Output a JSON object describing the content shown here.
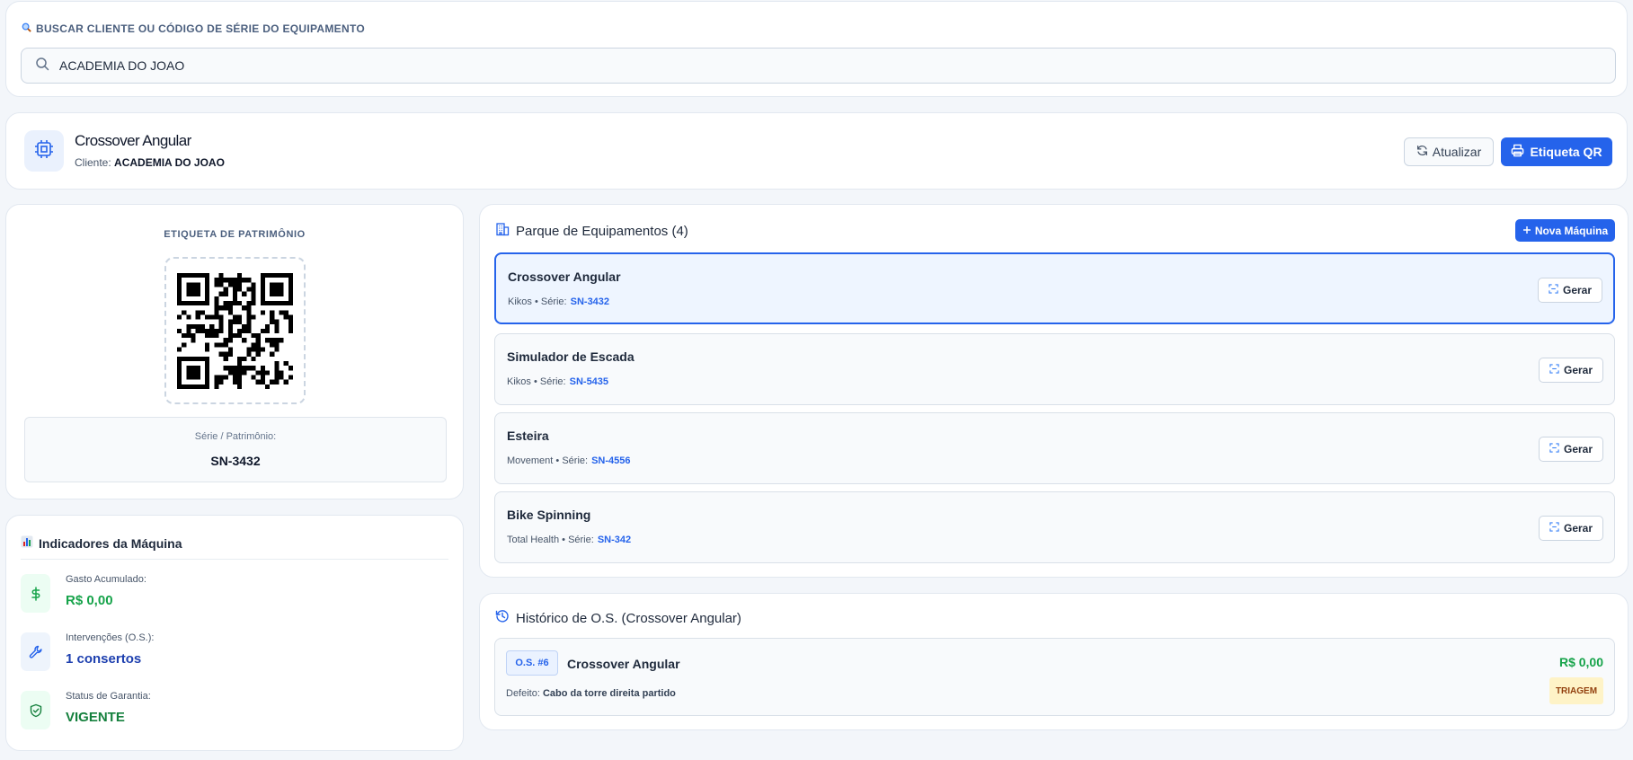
{
  "search": {
    "label": "BUSCAR CLIENTE OU CÓDIGO DE SÉRIE DO EQUIPAMENTO",
    "value": "ACADEMIA DO JOAO"
  },
  "header": {
    "title": "Crossover Angular",
    "client_label": "Cliente:",
    "client_name": "ACADEMIA DO JOAO",
    "refresh_label": "Atualizar",
    "qr_label": "Etiqueta QR"
  },
  "tag": {
    "title": "ETIQUETA DE PATRIMÔNIO",
    "serial_label": "Série / Patrimônio:",
    "serial_value": "SN-3432"
  },
  "indicators": {
    "title": "Indicadores da Máquina",
    "items": [
      {
        "label": "Gasto Acumulado:",
        "value": "R$ 0,00",
        "icon": "dollar-icon",
        "color": "#16a34a"
      },
      {
        "label": "Intervenções (O.S.):",
        "value": "1 consertos",
        "icon": "wrench-icon",
        "color": "#1e40af"
      },
      {
        "label": "Status de Garantia:",
        "value": "VIGENTE",
        "icon": "shield-check-icon",
        "color": "#15803d"
      }
    ]
  },
  "fleet": {
    "title": "Parque de Equipamentos (4)",
    "new_button": "Nova Máquina",
    "series_label": "Série:",
    "gerar_label": "Gerar",
    "items": [
      {
        "name": "Crossover Angular",
        "brand": "Kikos",
        "serial": "SN-3432",
        "selected": true
      },
      {
        "name": "Simulador de Escada",
        "brand": "Kikos",
        "serial": "SN-5435",
        "selected": false
      },
      {
        "name": "Esteira",
        "brand": "Movement",
        "serial": "SN-4556",
        "selected": false
      },
      {
        "name": "Bike Spinning",
        "brand": "Total Health",
        "serial": "SN-342",
        "selected": false
      }
    ]
  },
  "history": {
    "title": "Histórico de O.S. (Crossover Angular)",
    "items": [
      {
        "number": "O.S. #6",
        "machine": "Crossover Angular",
        "defect_label": "Defeito:",
        "defect": "Cabo da torre direita partido",
        "price": "R$ 0,00",
        "status": "TRIAGEM"
      }
    ]
  },
  "colors": {
    "accent": "#2563eb",
    "success": "#16a34a",
    "warning_bg": "#fef3c7"
  }
}
